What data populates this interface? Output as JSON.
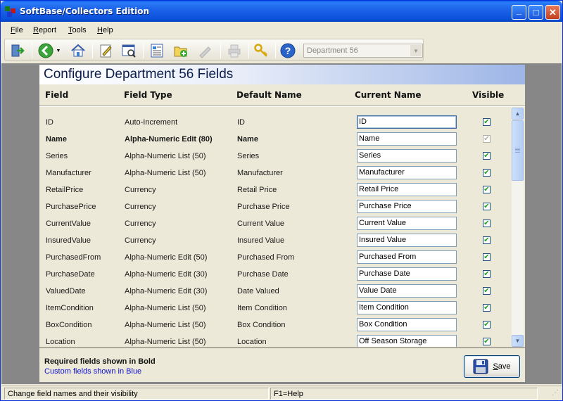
{
  "window": {
    "title": "SoftBase/Collectors Edition",
    "minimize": "_",
    "maximize": "□",
    "close": "✕"
  },
  "menu": [
    {
      "label": "File",
      "accel": "F",
      "rest": "ile"
    },
    {
      "label": "Report",
      "accel": "R",
      "rest": "eport"
    },
    {
      "label": "Tools",
      "accel": "T",
      "rest": "ools"
    },
    {
      "label": "Help",
      "accel": "H",
      "rest": "elp"
    }
  ],
  "toolbar": {
    "icons": [
      "exit-icon",
      "back-icon",
      "home-icon",
      "edit-icon",
      "find-icon",
      "report-icon",
      "new-folder-icon",
      "tag-icon",
      "print-icon",
      "keys-icon",
      "help-icon"
    ],
    "department_select": "Department 56"
  },
  "panel": {
    "title": "Configure Department 56 Fields",
    "columns": {
      "field": "Field",
      "type": "Field Type",
      "default": "Default Name",
      "current": "Current Name",
      "visible": "Visible"
    },
    "rows": [
      {
        "field": "ID",
        "type": "Auto-Increment",
        "default": "ID",
        "current": "ID",
        "visible": true,
        "bold": false
      },
      {
        "field": "Name",
        "type": "Alpha-Numeric Edit (80)",
        "default": "Name",
        "current": "Name",
        "visible": true,
        "bold": true
      },
      {
        "field": "Series",
        "type": "Alpha-Numeric List (50)",
        "default": "Series",
        "current": "Series",
        "visible": true,
        "bold": false
      },
      {
        "field": "Manufacturer",
        "type": "Alpha-Numeric List (50)",
        "default": "Manufacturer",
        "current": "Manufacturer",
        "visible": true,
        "bold": false
      },
      {
        "field": "RetailPrice",
        "type": "Currency",
        "default": "Retail Price",
        "current": "Retail Price",
        "visible": true,
        "bold": false
      },
      {
        "field": "PurchasePrice",
        "type": "Currency",
        "default": "Purchase Price",
        "current": "Purchase Price",
        "visible": true,
        "bold": false
      },
      {
        "field": "CurrentValue",
        "type": "Currency",
        "default": "Current Value",
        "current": "Current Value",
        "visible": true,
        "bold": false
      },
      {
        "field": "InsuredValue",
        "type": "Currency",
        "default": "Insured Value",
        "current": "Insured Value",
        "visible": true,
        "bold": false
      },
      {
        "field": "PurchasedFrom",
        "type": "Alpha-Numeric Edit (50)",
        "default": "Purchased From",
        "current": "Purchased From",
        "visible": true,
        "bold": false
      },
      {
        "field": "PurchaseDate",
        "type": "Alpha-Numeric Edit (30)",
        "default": "Purchase Date",
        "current": "Purchase Date",
        "visible": true,
        "bold": false
      },
      {
        "field": "ValuedDate",
        "type": "Alpha-Numeric Edit (30)",
        "default": "Date Valued",
        "current": "Value Date",
        "visible": true,
        "bold": false
      },
      {
        "field": "ItemCondition",
        "type": "Alpha-Numeric List (50)",
        "default": "Item Condition",
        "current": "Item Condition",
        "visible": true,
        "bold": false
      },
      {
        "field": "BoxCondition",
        "type": "Alpha-Numeric List (50)",
        "default": "Box Condition",
        "current": "Box Condition",
        "visible": true,
        "bold": false
      },
      {
        "field": "Location",
        "type": "Alpha-Numeric List (50)",
        "default": "Location",
        "current": "Off Season Storage",
        "visible": true,
        "bold": false
      }
    ],
    "legend_required": "Required fields shown in Bold",
    "legend_custom": "Custom fields shown in Blue",
    "save": {
      "accel": "S",
      "rest": "ave"
    }
  },
  "status": {
    "message": "Change field names and their visibility",
    "help": "F1=Help"
  },
  "colors": {
    "title_bar": "#0a4fd8",
    "custom_field_text": "#1010d0",
    "check": "#21a121"
  }
}
